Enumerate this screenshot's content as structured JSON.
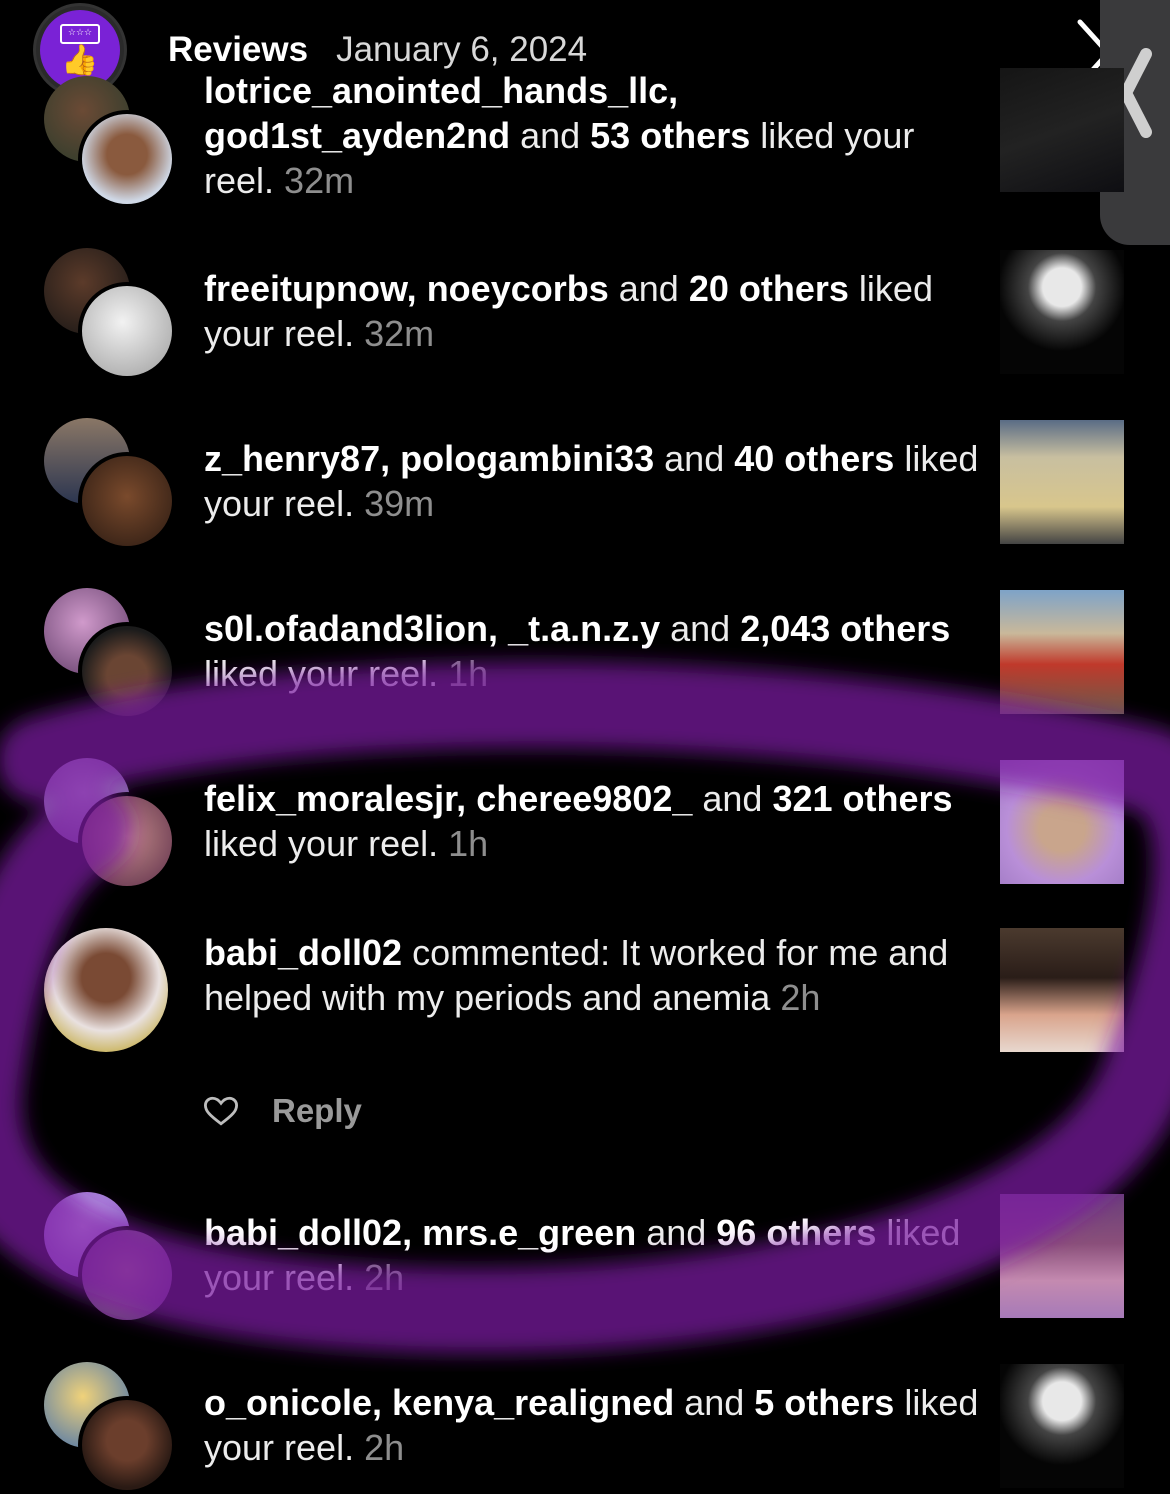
{
  "header": {
    "title": "Reviews",
    "date": "January 6, 2024"
  },
  "notifications": [
    {
      "users": [
        "lotrice_anointed_hands_llc",
        "god1st_ayden2nd"
      ],
      "others_count": "53 others",
      "action": "liked your reel.",
      "time": "32m"
    },
    {
      "users": [
        "freeitupnow",
        "noeycorbs"
      ],
      "others_count": "20 others",
      "action": "liked your reel.",
      "time": "32m"
    },
    {
      "users": [
        "z_henry87",
        "pologambini33"
      ],
      "others_count": "40 others",
      "action": "liked your reel.",
      "time": "39m"
    },
    {
      "users": [
        "s0l.ofadand3lion",
        "_t.a.n.z.y"
      ],
      "others_count": "2,043 others",
      "action": "liked your reel.",
      "time": "1h"
    },
    {
      "users": [
        "felix_moralesjr",
        "cheree9802_"
      ],
      "others_count": "321 others",
      "action": "liked your reel.",
      "time": "1h"
    },
    {
      "user": "babi_doll02",
      "action": "commented: It worked for me and helped with my periods and anemia",
      "time": "2h",
      "reply_label": "Reply"
    },
    {
      "users": [
        "babi_doll02",
        "mrs.e_green"
      ],
      "others_count": "96 others",
      "action": "liked your reel.",
      "time": "2h"
    },
    {
      "users": [
        "o_onicole",
        "kenya_realigned"
      ],
      "others_count": "5 others",
      "action": "liked your reel.",
      "time": "2h"
    }
  ],
  "colors": {
    "background": "#000000",
    "overlay_purple": "#7b1fa2",
    "logo_purple": "#7a22d6",
    "time_gray": "#8e8e8e"
  },
  "icons": {
    "logo": "reviews-thumbs-up-icon",
    "next": "chevron-right-icon",
    "side": "chevron-left-icon",
    "like": "heart-outline-icon"
  }
}
